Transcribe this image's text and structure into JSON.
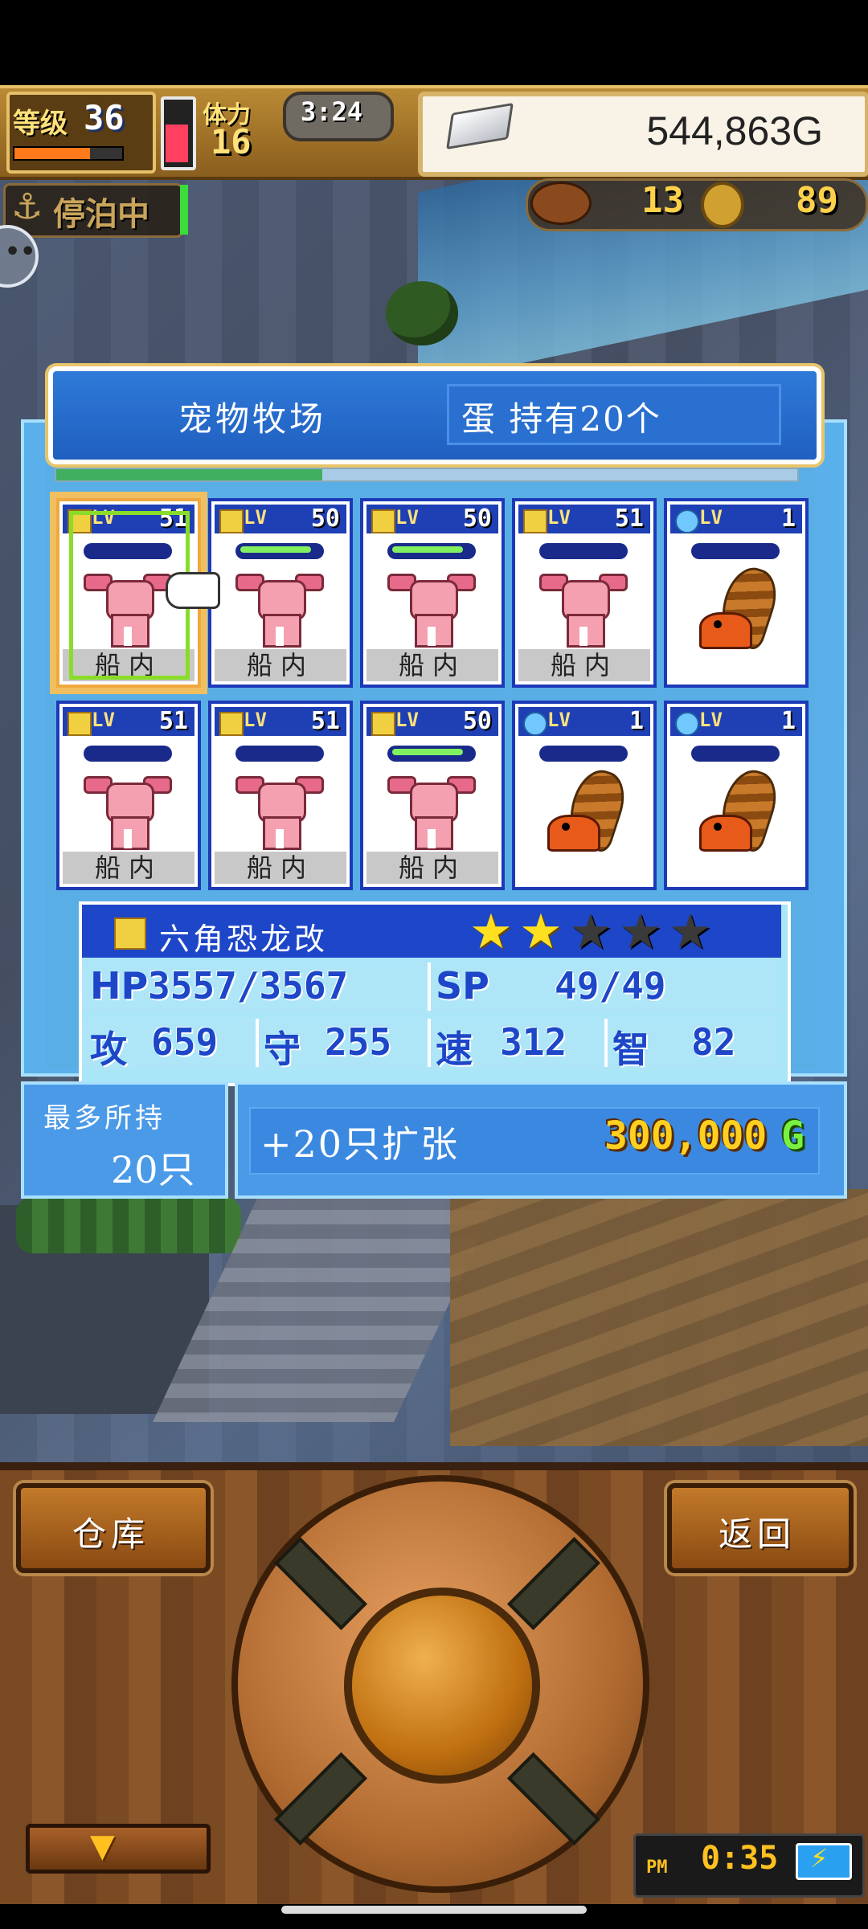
{
  "status": {
    "level_label": "等级",
    "level": "36",
    "xp_fraction": 0.7,
    "stamina_label": "体力",
    "stamina": "16",
    "stamina_fraction": 0.62,
    "clock": "3:24",
    "gold": "544,863G",
    "docked_label": "停泊中",
    "food": "13",
    "coins": "89"
  },
  "panel": {
    "title": "宠物牧场",
    "egg_count": "蛋 持有20个",
    "progress_fraction": 0.36,
    "pets": [
      {
        "element": "thunder",
        "lv_label": "LV",
        "level": "51",
        "hp_fraction": 0.0,
        "location": "船内",
        "species": "axolotl",
        "selected": true
      },
      {
        "element": "thunder",
        "lv_label": "LV",
        "level": "50",
        "hp_fraction": 0.9,
        "location": "船内",
        "species": "axolotl",
        "selected": false
      },
      {
        "element": "thunder",
        "lv_label": "LV",
        "level": "50",
        "hp_fraction": 0.9,
        "location": "船内",
        "species": "axolotl",
        "selected": false
      },
      {
        "element": "thunder",
        "lv_label": "LV",
        "level": "51",
        "hp_fraction": 0.0,
        "location": "船内",
        "species": "axolotl",
        "selected": false
      },
      {
        "element": "water",
        "lv_label": "LV",
        "level": "1",
        "hp_fraction": 0.0,
        "location": "",
        "species": "hermit-crab",
        "selected": false
      },
      {
        "element": "thunder",
        "lv_label": "LV",
        "level": "51",
        "hp_fraction": 0.0,
        "location": "船内",
        "species": "axolotl",
        "selected": false
      },
      {
        "element": "thunder",
        "lv_label": "LV",
        "level": "51",
        "hp_fraction": 0.0,
        "location": "船内",
        "species": "axolotl",
        "selected": false
      },
      {
        "element": "thunder",
        "lv_label": "LV",
        "level": "50",
        "hp_fraction": 0.9,
        "location": "船内",
        "species": "axolotl",
        "selected": false
      },
      {
        "element": "water",
        "lv_label": "LV",
        "level": "1",
        "hp_fraction": 0.0,
        "location": "",
        "species": "hermit-crab",
        "selected": false
      },
      {
        "element": "water",
        "lv_label": "LV",
        "level": "1",
        "hp_fraction": 0.0,
        "location": "",
        "species": "hermit-crab",
        "selected": false
      }
    ]
  },
  "detail": {
    "name": "六角恐龙改",
    "stars_filled": 2,
    "stars_total": 5,
    "hp_label": "HP",
    "hp": "3557/3567",
    "sp_label": "SP",
    "sp": "49/49",
    "atk_label": "攻",
    "atk": "659",
    "def_label": "守",
    "def": "255",
    "spd_label": "速",
    "spd": "312",
    "int_label": "智",
    "int": "82"
  },
  "capacity": {
    "max_label": "最多所持",
    "max_value": "20只",
    "expand_label": "+20只扩张",
    "expand_price": "300,000",
    "expand_currency": "G"
  },
  "controls": {
    "warehouse": "仓库",
    "back": "返回",
    "down_icon": "▼"
  },
  "system": {
    "ampm": "PM",
    "time": "0:35",
    "battery_icon": "⚡"
  },
  "colors": {
    "panel_blue": "#5ab0ea",
    "title_blue": "#1f5fc0",
    "gold_text": "#ffd020",
    "hp_green": "#80f060"
  }
}
